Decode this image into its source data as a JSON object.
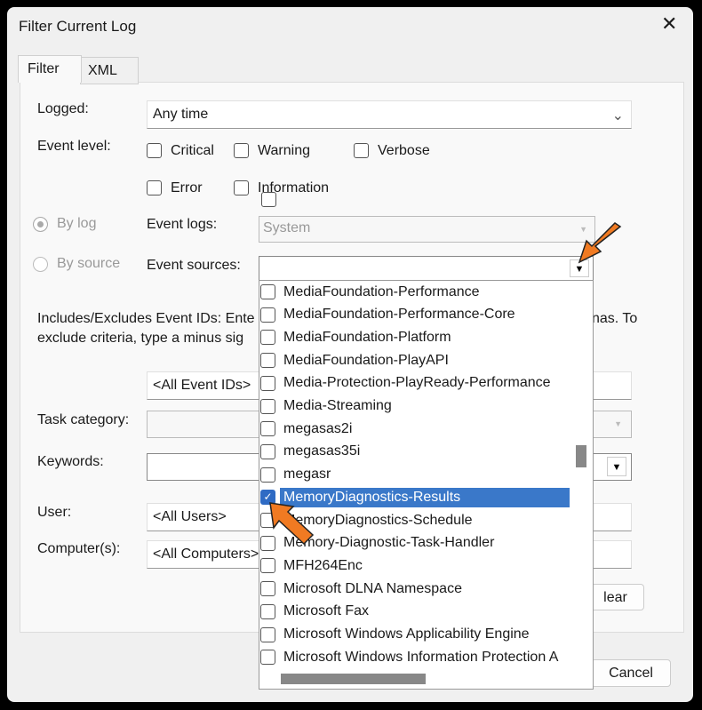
{
  "window": {
    "title": "Filter Current Log"
  },
  "tabs": [
    {
      "label": "Filter"
    },
    {
      "label": "XML"
    }
  ],
  "logged": {
    "label": "Logged:",
    "value": "Any time"
  },
  "event_level": {
    "label": "Event level:",
    "options": [
      {
        "label": "Critical",
        "checked": false
      },
      {
        "label": "Warning",
        "checked": false
      },
      {
        "label": "Verbose",
        "checked": false
      },
      {
        "label": "Error",
        "checked": false
      },
      {
        "label": "Information",
        "checked": false
      }
    ]
  },
  "by_log": {
    "label": "By log",
    "selected": true
  },
  "by_source": {
    "label": "By source",
    "selected": false
  },
  "event_logs": {
    "label": "Event logs:",
    "value": "System"
  },
  "event_sources": {
    "label": "Event sources:",
    "value": ""
  },
  "event_ids": {
    "text1": "Includes/Excludes Event IDs: Ente",
    "text1_end": "nas. To",
    "text2": "exclude criteria, type a minus sig",
    "value": "<All Event IDs>"
  },
  "task_category": {
    "label": "Task category:"
  },
  "keywords": {
    "label": "Keywords:"
  },
  "user": {
    "label": "User:",
    "value": "<All Users>"
  },
  "computers": {
    "label": "Computer(s):",
    "value": "<All Computers>"
  },
  "buttons": {
    "clear": "lear",
    "cancel": "Cancel"
  },
  "sources_list": [
    {
      "label": "MediaFoundation-Performance",
      "checked": false
    },
    {
      "label": "MediaFoundation-Performance-Core",
      "checked": false
    },
    {
      "label": "MediaFoundation-Platform",
      "checked": false
    },
    {
      "label": "MediaFoundation-PlayAPI",
      "checked": false
    },
    {
      "label": "Media-Protection-PlayReady-Performance",
      "checked": false
    },
    {
      "label": "Media-Streaming",
      "checked": false
    },
    {
      "label": "megasas2i",
      "checked": false
    },
    {
      "label": "megasas35i",
      "checked": false
    },
    {
      "label": "megasr",
      "checked": false
    },
    {
      "label": "MemoryDiagnostics-Results",
      "checked": true
    },
    {
      "label": "MemoryDiagnostics-Schedule",
      "checked": false
    },
    {
      "label": "Memory-Diagnostic-Task-Handler",
      "checked": false
    },
    {
      "label": "MFH264Enc",
      "checked": false
    },
    {
      "label": "Microsoft DLNA Namespace",
      "checked": false
    },
    {
      "label": "Microsoft Fax",
      "checked": false
    },
    {
      "label": "Microsoft Windows Applicability Engine",
      "checked": false
    },
    {
      "label": "Microsoft Windows Information Protection A",
      "checked": false
    }
  ],
  "colors": {
    "accent": "#3a78c9",
    "annotation": "#f07a22"
  }
}
